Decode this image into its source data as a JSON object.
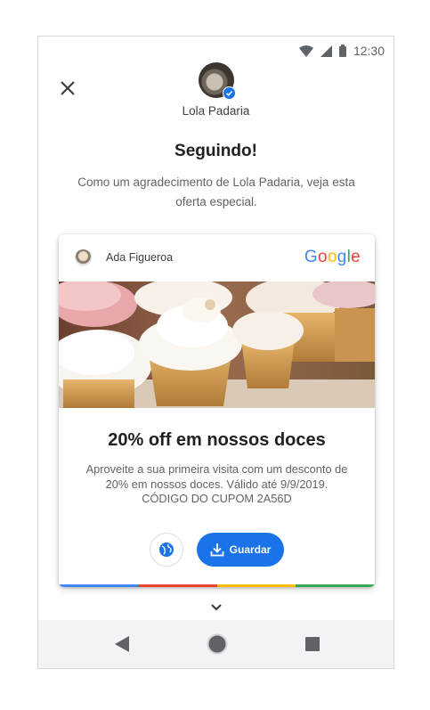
{
  "status_bar": {
    "time": "12:30"
  },
  "header": {
    "business_name": "Lola Padaria",
    "title": "Seguindo!",
    "subtitle": "Como um agradecimento de Lola Padaria, veja esta oferta especial."
  },
  "card": {
    "poster_name": "Ada Figueroa",
    "google_logo": {
      "letters": [
        "G",
        "o",
        "o",
        "g",
        "l",
        "e"
      ],
      "colors": [
        "#4285F4",
        "#EA4335",
        "#FBBC05",
        "#4285F4",
        "#34A853",
        "#EA4335"
      ]
    },
    "offer_title": "20% off em nossos doces",
    "offer_description": "Aproveite a sua primeira visita com um desconto de 20% em nossos doces. Válido até 9/9/2019. CÓDIGO DO CUPOM 2A56D",
    "save_label": "Guardar",
    "strip_colors": [
      "#4285F4",
      "#EA4335",
      "#FBBC05",
      "#34A853"
    ]
  },
  "colors": {
    "accent": "#1a73e8",
    "nav_background": "#f1f3f4"
  },
  "icons": [
    "wifi-icon",
    "signal-icon",
    "battery-icon",
    "close-icon",
    "verified-icon",
    "globe-icon",
    "download-icon",
    "chevron-down-icon",
    "back-icon",
    "home-icon",
    "recents-icon"
  ]
}
